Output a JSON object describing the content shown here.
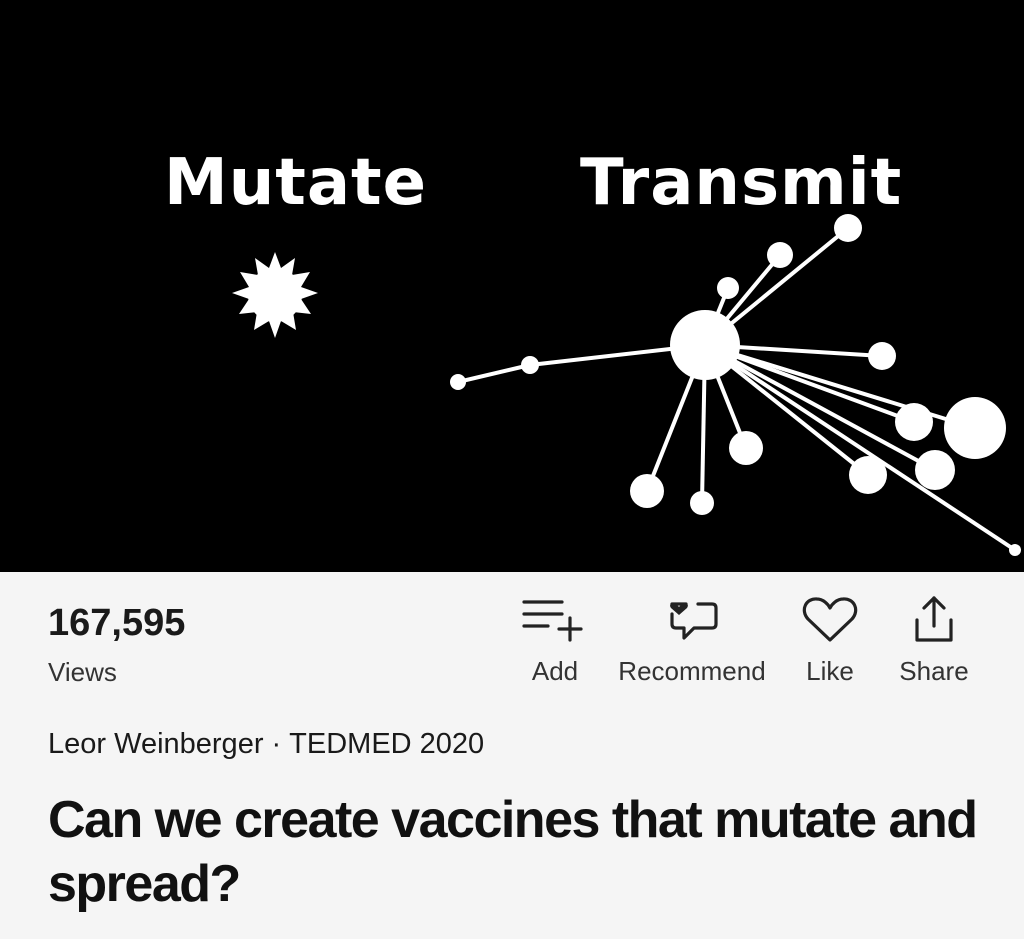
{
  "video": {
    "label_left": "Mutate",
    "label_right": "Transmit"
  },
  "stats": {
    "views_count": "167,595",
    "views_label": "Views"
  },
  "actions": {
    "add": "Add",
    "recommend": "Recommend",
    "like": "Like",
    "share": "Share"
  },
  "talk": {
    "speaker": "Leor Weinberger",
    "separator": "·",
    "event": "TEDMED 2020",
    "title": "Can we create vaccines that mutate and spread?"
  },
  "colors": {
    "video_bg": "#000000",
    "page_bg": "#f5f5f5",
    "text": "#1a1a1a"
  }
}
